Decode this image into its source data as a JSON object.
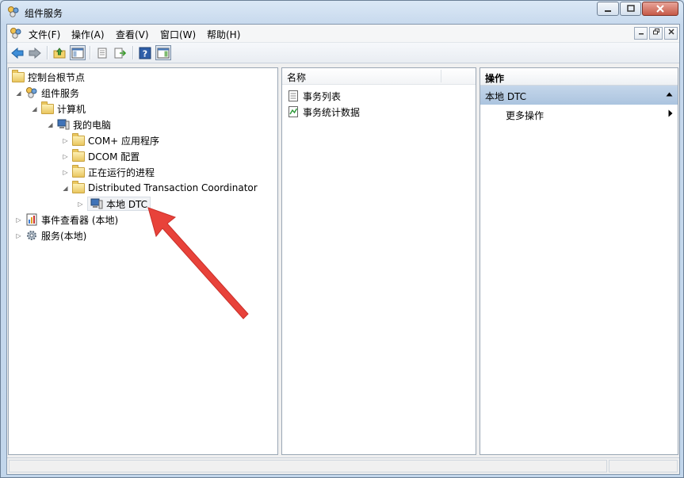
{
  "window": {
    "title": "组件服务"
  },
  "menu": [
    "文件(F)",
    "操作(A)",
    "查看(V)",
    "窗口(W)",
    "帮助(H)"
  ],
  "toolbar": {
    "buttons": [
      "back-icon",
      "forward-icon",
      "up-folder-icon",
      "show-hide-tree-icon",
      "properties-icon",
      "export-list-icon",
      "help-icon",
      "show-hide-action-pane-icon"
    ]
  },
  "tree": {
    "root": "控制台根节点",
    "component_services": "组件服务",
    "computers": "计算机",
    "my_computer": "我的电脑",
    "com_apps": "COM+ 应用程序",
    "dcom_config": "DCOM 配置",
    "running_processes": "正在运行的进程",
    "dtc": "Distributed Transaction Coordinator",
    "local_dtc": "本地 DTC",
    "event_viewer": "事件查看器 (本地)",
    "services": "服务(本地)"
  },
  "list": {
    "column_name": "名称",
    "items": [
      "事务列表",
      "事务统计数据"
    ]
  },
  "actions": {
    "header": "操作",
    "section": "本地 DTC",
    "more": "更多操作"
  },
  "colors": {
    "selection_band": "#b8cde4",
    "annotation_arrow": "#e8423a"
  }
}
